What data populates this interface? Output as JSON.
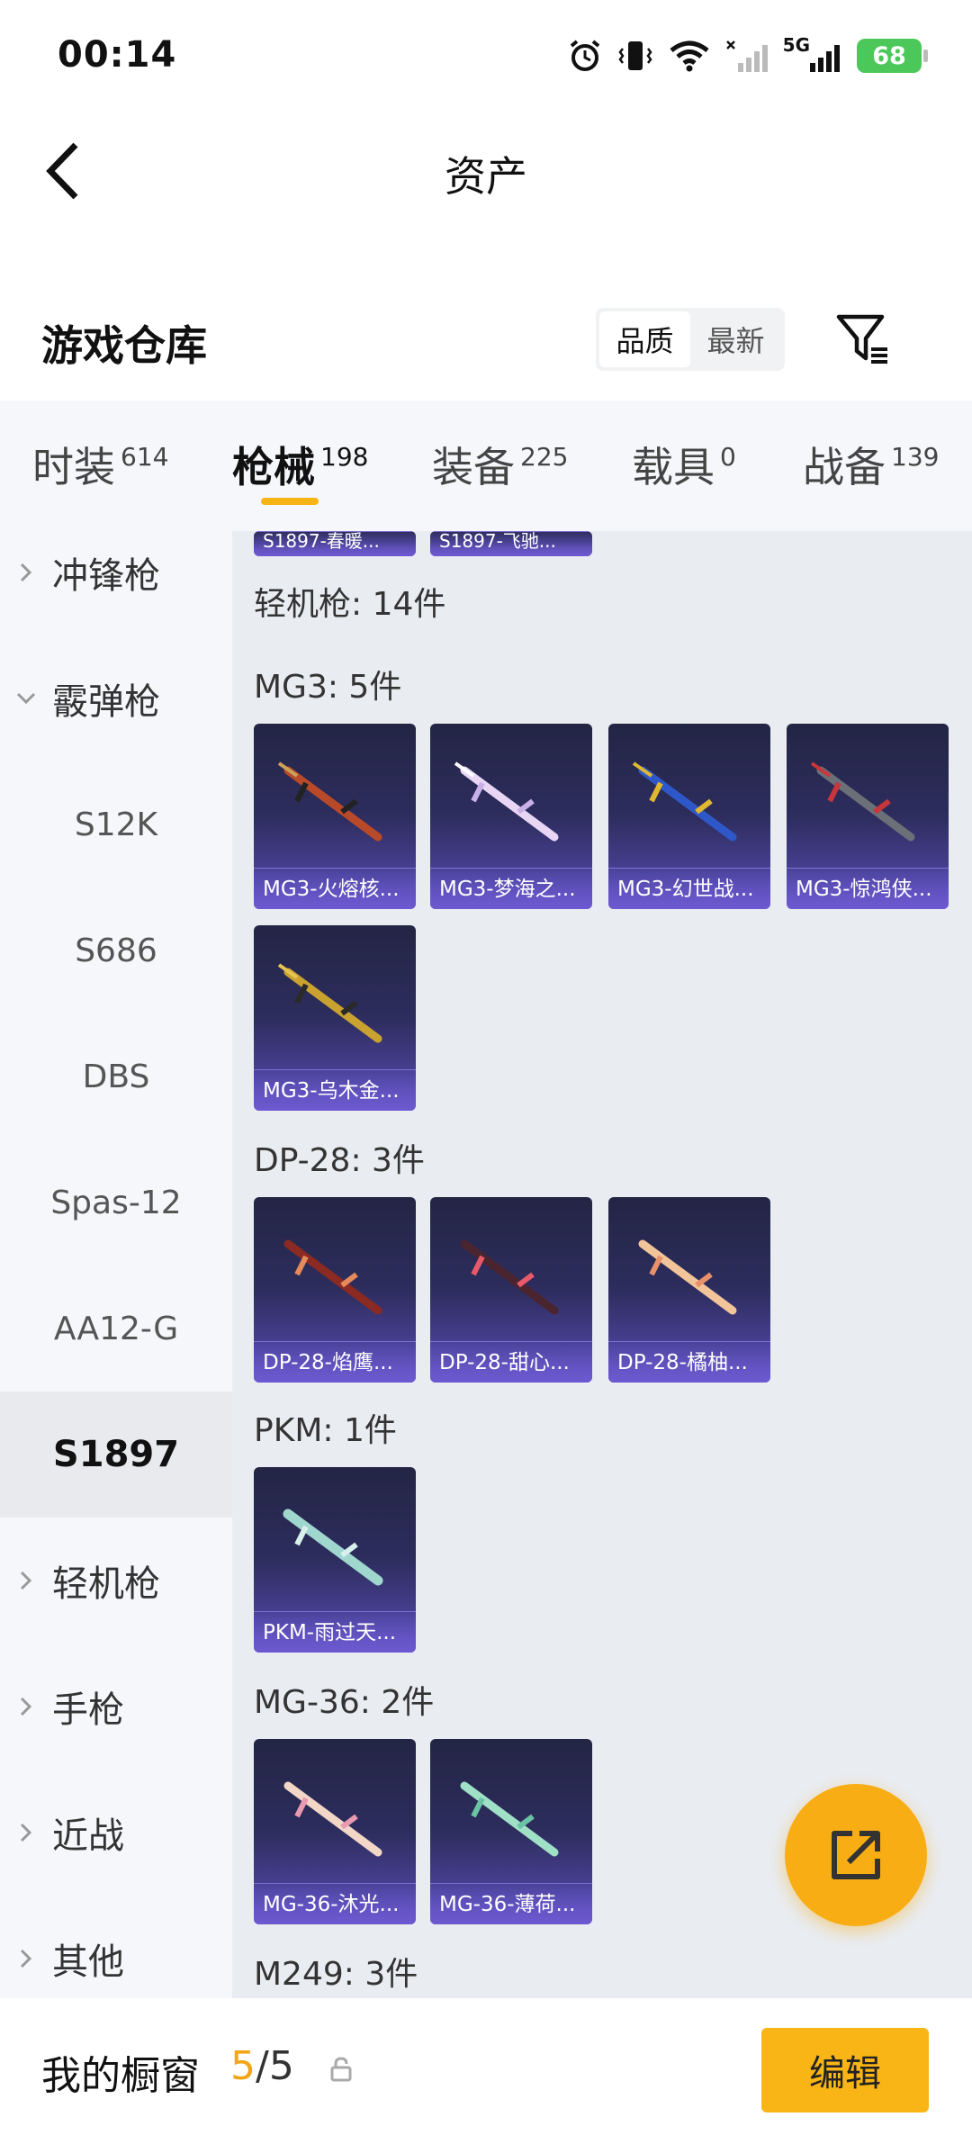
{
  "status_bar": {
    "time": "00:14",
    "network": "5G",
    "battery": "68"
  },
  "header": {
    "title": "资产"
  },
  "warehouse": {
    "title": "游戏仓库",
    "sort_options": [
      "品质",
      "最新"
    ]
  },
  "tabs": [
    {
      "label": "时装",
      "count": "614"
    },
    {
      "label": "枪械",
      "count": "198"
    },
    {
      "label": "装备",
      "count": "225"
    },
    {
      "label": "载具",
      "count": "0"
    },
    {
      "label": "战备",
      "count": "139"
    }
  ],
  "sidebar": {
    "smg": "冲锋枪",
    "shotgun": "霰弹枪",
    "sub_items": [
      "S12K",
      "S686",
      "DBS",
      "Spas-12",
      "AA12-G"
    ],
    "selected": "S1897",
    "lmg": "轻机枪",
    "pistol": "手枪",
    "melee": "近战",
    "other": "其他"
  },
  "content": {
    "top_partial": [
      "S1897-春暖...",
      "S1897-飞驰..."
    ],
    "category_header": "轻机枪: 14件",
    "groups": [
      {
        "title": "MG3: 5件",
        "items": [
          "MG3-火熔核...",
          "MG3-梦海之...",
          "MG3-幻世战...",
          "MG3-惊鸿侠...",
          "MG3-乌木金..."
        ]
      },
      {
        "title": "DP-28: 3件",
        "items": [
          "DP-28-焰鹰...",
          "DP-28-甜心...",
          "DP-28-橘柚..."
        ]
      },
      {
        "title": "PKM: 1件",
        "items": [
          "PKM-雨过天..."
        ]
      },
      {
        "title": "MG-36: 2件",
        "items": [
          "MG-36-沐光...",
          "MG-36-薄荷..."
        ]
      },
      {
        "title": "M249: 3件",
        "items": []
      }
    ]
  },
  "bottom_bar": {
    "title": "我的橱窗",
    "current": "5",
    "total": "/5",
    "edit_label": "编辑"
  },
  "colors": {
    "accent": "#f8b515",
    "card_top": "#232544",
    "card_bottom": "#5a4db6"
  }
}
